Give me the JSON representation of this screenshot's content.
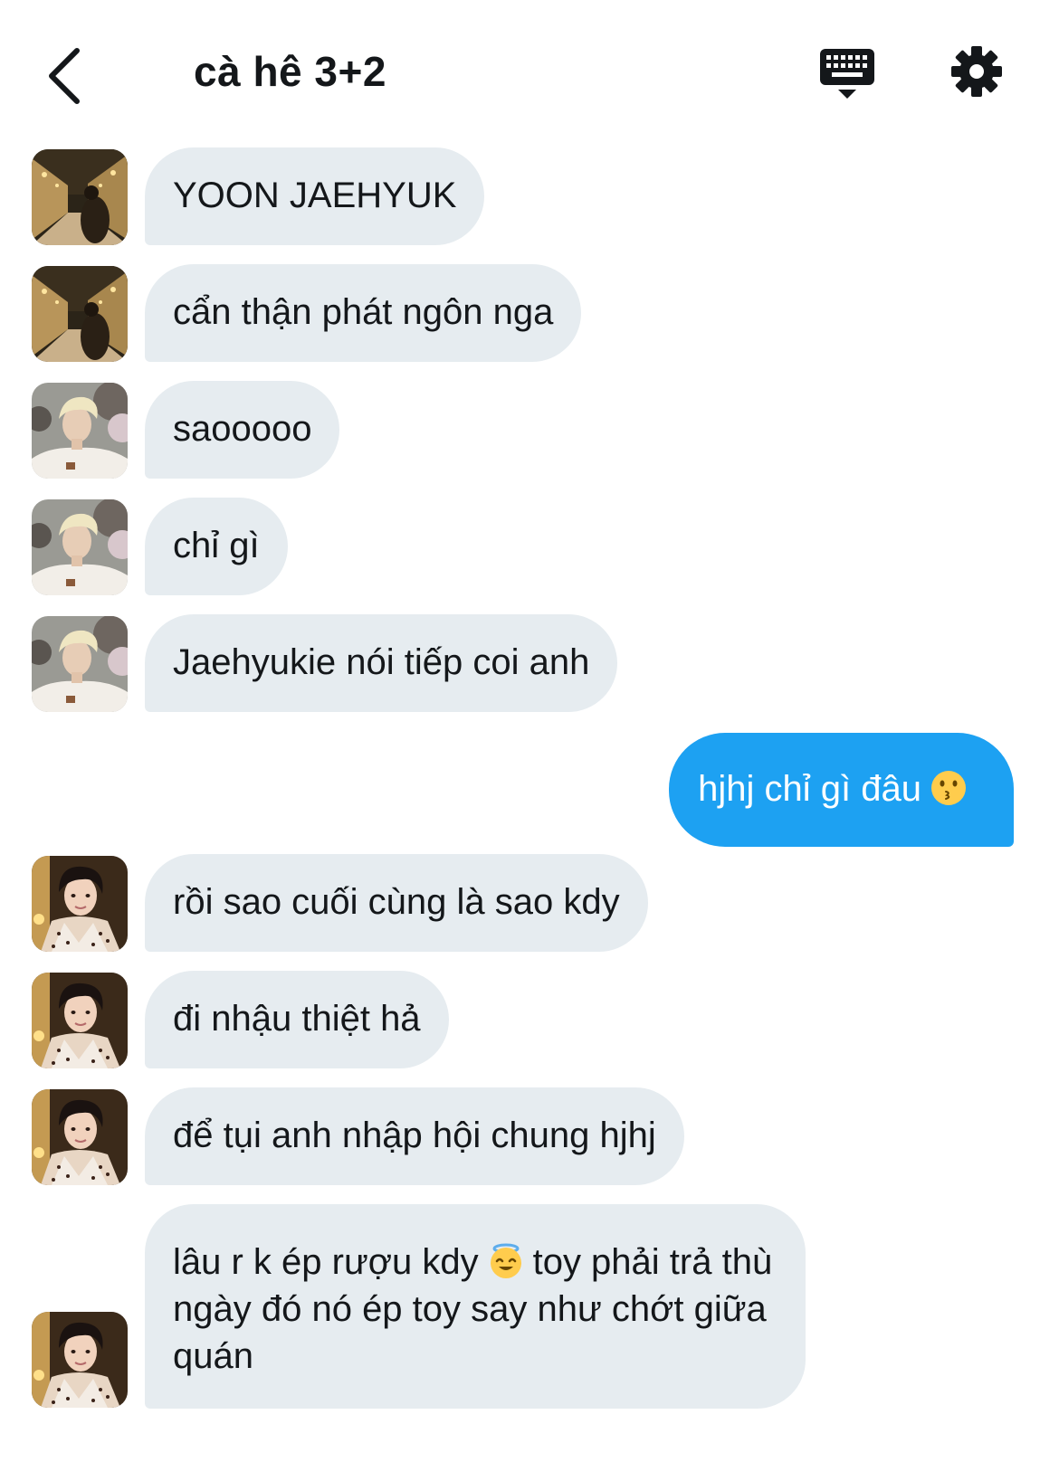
{
  "header": {
    "title": "cà hê 3+2",
    "back_icon": "chevron-left-icon",
    "keyboard_icon": "keyboard-icon",
    "settings_icon": "gear-icon"
  },
  "colors": {
    "incoming_bubble": "#e6ecf0",
    "outgoing_bubble": "#1da1f2",
    "text": "#14171a"
  },
  "messages": [
    {
      "sender": "avatar-night-street",
      "text": "YOON JAEHYUK",
      "direction": "in"
    },
    {
      "sender": "avatar-night-street",
      "text": "cẩn thận phát ngôn nga",
      "direction": "in"
    },
    {
      "sender": "avatar-blond-boy",
      "text": "saooooo",
      "direction": "in"
    },
    {
      "sender": "avatar-blond-boy",
      "text": "chỉ gì",
      "direction": "in"
    },
    {
      "sender": "avatar-blond-boy",
      "text": "Jaehyukie nói tiếp coi anh",
      "direction": "in"
    },
    {
      "sender": "me",
      "text": "hjhj chỉ gì đâu",
      "emoji": "kissing-face-emoji",
      "direction": "out"
    },
    {
      "sender": "avatar-dark-hair-boy",
      "text": "rồi sao cuối cùng là sao kdy",
      "direction": "in"
    },
    {
      "sender": "avatar-dark-hair-boy",
      "text": "đi nhậu thiệt hả",
      "direction": "in"
    },
    {
      "sender": "avatar-dark-hair-boy",
      "text": "để tụi anh nhập hội chung hjhj",
      "direction": "in"
    },
    {
      "sender": "avatar-dark-hair-boy",
      "text_before": "lâu r k ép rượu kdy",
      "emoji": "halo-face-emoji",
      "text_after": "toy phải trả thù ngày đó nó ép toy say như chớt giữa quán",
      "direction": "in"
    }
  ]
}
